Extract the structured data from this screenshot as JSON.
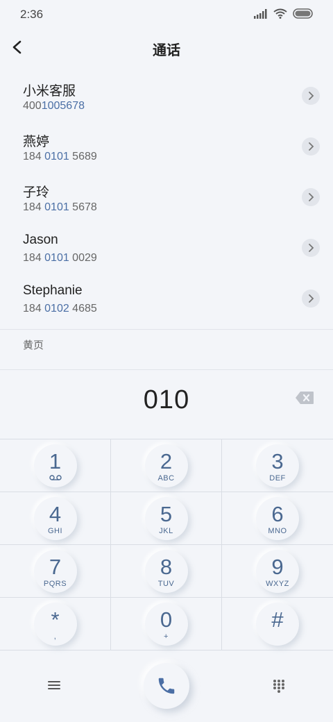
{
  "status_bar": {
    "time": "2:36"
  },
  "header": {
    "title": "通话"
  },
  "contacts": [
    {
      "name": "小米客服",
      "number_pre": "400",
      "number_match": "1005678",
      "number_post": ""
    },
    {
      "name": "燕婷",
      "number_pre": "184 ",
      "number_match": "0101",
      "number_post": " 5689"
    },
    {
      "name": "子玲",
      "number_pre": "184 ",
      "number_match": "0101",
      "number_post": " 5678"
    },
    {
      "name": "Jason",
      "number_pre": "184 ",
      "number_match": "0101",
      "number_post": " 0029"
    },
    {
      "name": "Stephanie",
      "number_pre": "184 ",
      "number_match": "0102",
      "number_post": " 4685"
    }
  ],
  "yellow_pages_label": "黄页",
  "dialer": {
    "input": "010"
  },
  "keypad": [
    {
      "digit": "1",
      "letters": ""
    },
    {
      "digit": "2",
      "letters": "ABC"
    },
    {
      "digit": "3",
      "letters": "DEF"
    },
    {
      "digit": "4",
      "letters": "GHI"
    },
    {
      "digit": "5",
      "letters": "JKL"
    },
    {
      "digit": "6",
      "letters": "MNO"
    },
    {
      "digit": "7",
      "letters": "PQRS"
    },
    {
      "digit": "8",
      "letters": "TUV"
    },
    {
      "digit": "9",
      "letters": "WXYZ"
    },
    {
      "digit": "*",
      "letters": ","
    },
    {
      "digit": "0",
      "letters": "+"
    },
    {
      "digit": "#",
      "letters": ""
    }
  ],
  "colors": {
    "accent": "#4a6890",
    "highlight": "#4b6fa5",
    "background": "#f3f5f9"
  },
  "icons": [
    "signal-icon",
    "wifi-icon",
    "battery-icon",
    "back-arrow-icon",
    "chevron-right-icon",
    "backspace-icon",
    "voicemail-icon",
    "menu-icon",
    "phone-icon",
    "keypad-icon"
  ]
}
